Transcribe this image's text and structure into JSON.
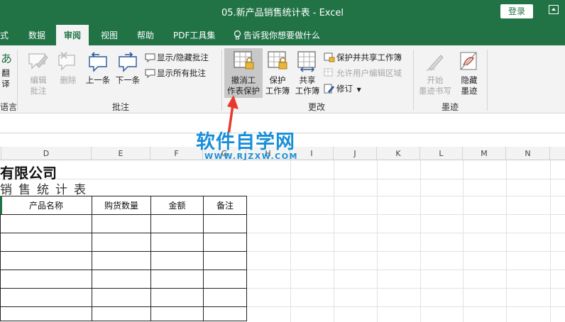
{
  "window": {
    "title": "05.新产品销售统计表  -  Excel",
    "login_label": "登录"
  },
  "tabs": [
    {
      "label": "式"
    },
    {
      "label": "数据"
    },
    {
      "label": "审阅"
    },
    {
      "label": "视图"
    },
    {
      "label": "帮助"
    },
    {
      "label": "PDF工具集"
    },
    {
      "label": "告诉我你想要做什么"
    }
  ],
  "ribbon": {
    "lang": {
      "line1": "翻",
      "line2": "译",
      "group": "语言"
    },
    "comments": {
      "group": "批注",
      "edit_line1": "编辑",
      "edit_line2": "批注",
      "delete": "删除",
      "prev": "上一条",
      "next": "下一条",
      "show_hide": "显示/隐藏批注",
      "show_all": "显示所有批注"
    },
    "changes": {
      "group": "更改",
      "unprotect_line1": "撤消工",
      "unprotect_line2": "作表保护",
      "protect_wb_line1": "保护",
      "protect_wb_line2": "工作簿",
      "share_wb_line1": "共享",
      "share_wb_line2": "工作簿",
      "protect_share": "保护并共享工作簿",
      "allow_edit": "允许用户编辑区域",
      "track": "修订"
    },
    "ink": {
      "group": "墨迹",
      "start_line1": "开始",
      "start_line2": "墨迹书写",
      "hide_line1": "隐藏",
      "hide_line2": "墨迹"
    }
  },
  "columns": [
    "D",
    "E",
    "F",
    "G",
    "H",
    "I",
    "J",
    "K",
    "L",
    "M",
    "N"
  ],
  "sheet": {
    "company": "有限公司",
    "subtitle": "销售统计表",
    "table_headers": [
      "产品名称",
      "购货数量",
      "金额",
      "备注"
    ]
  },
  "watermark": {
    "text": "软件自学网",
    "url": "WWW.RJZXW.COM"
  },
  "colors": {
    "excel_green": "#217346",
    "arrow_red": "#e8392c",
    "watermark_blue": "#1a8fd8"
  }
}
